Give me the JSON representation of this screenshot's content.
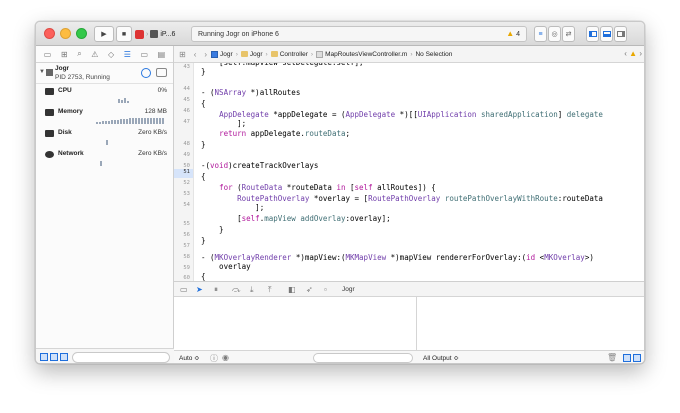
{
  "toolbar": {
    "scheme_label": "iP...6",
    "activity_text": "Running Jogr on iPhone 6",
    "warning_count": "4",
    "play_glyph": "▶",
    "stop_glyph": "■"
  },
  "navigator": {
    "process": {
      "name": "Jogr",
      "pid_status": "PID 2753, Running"
    },
    "gauges": [
      {
        "label": "CPU",
        "value": "0%"
      },
      {
        "label": "Memory",
        "value": "128 MB"
      },
      {
        "label": "Disk",
        "value": "Zero KB/s"
      },
      {
        "label": "Network",
        "value": "Zero KB/s"
      }
    ]
  },
  "jumpbar": {
    "crumbs": [
      "Jogr",
      "Jogr",
      "Controller",
      "MapRoutesViewController.m",
      "No Selection"
    ]
  },
  "editor": {
    "current_line": "51",
    "line_numbers": [
      "43",
      "44",
      "45",
      "46",
      "47",
      "48",
      "49",
      "50",
      "51",
      "52",
      "53",
      "54",
      "55",
      "56",
      "57",
      "58",
      "59",
      "60",
      "61"
    ]
  },
  "debug": {
    "process_label": "Jogr",
    "auto_label": "Auto ≎",
    "output_label": "All Output ≎"
  },
  "colors": {
    "accent": "#1f6fdc",
    "keyword": "#b0179b",
    "class_name": "#703daa",
    "method": "#3f6e74"
  }
}
